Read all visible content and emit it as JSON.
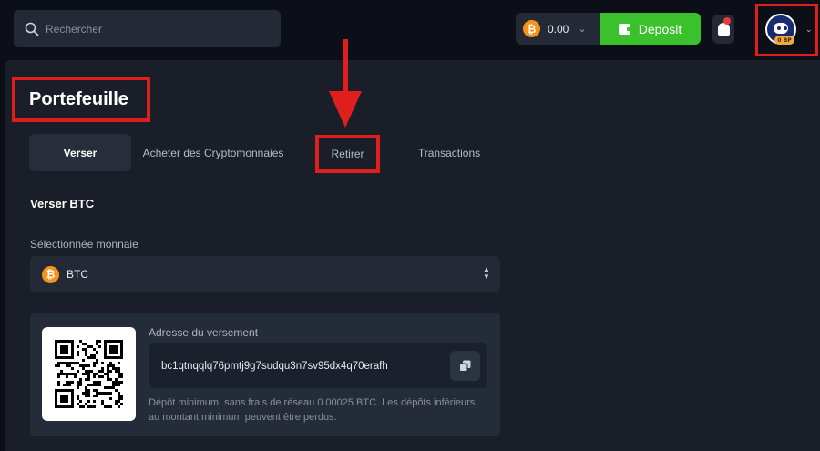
{
  "header": {
    "search_placeholder": "Rechercher",
    "balance": "0.00",
    "coin_symbol": "₿",
    "deposit_label": "Deposit",
    "vip_badge": "0 BP"
  },
  "page": {
    "title": "Portefeuille"
  },
  "tabs": [
    {
      "label": "Verser",
      "active": true
    },
    {
      "label": "Acheter des Cryptomonnaies",
      "active": false
    },
    {
      "label": "Retirer",
      "active": false
    },
    {
      "label": "Transactions",
      "active": false
    }
  ],
  "deposit": {
    "section_title": "Verser BTC",
    "currency_label": "Sélectionnée monnaie",
    "currency_name": "BTC",
    "address_label": "Adresse du versement",
    "address": "bc1qtnqqlq76pmtj9g7sudqu3n7sv95dx4q70erafh",
    "note": "Dépôt minimum, sans frais de réseau 0.00025 BTC. Les dépôts inférieurs au montant minimum peuvent être perdus."
  },
  "colors": {
    "accent_green": "#3bc12b",
    "btc_orange": "#f7931a",
    "highlight_red": "#e01e1e",
    "background": "#0c0f17",
    "panel": "#191e28"
  },
  "icons": [
    "search-icon",
    "bitcoin-icon",
    "chevron-down-icon",
    "wallet-icon",
    "bell-icon",
    "avatar",
    "updown-icon",
    "qr-code",
    "copy-icon"
  ]
}
